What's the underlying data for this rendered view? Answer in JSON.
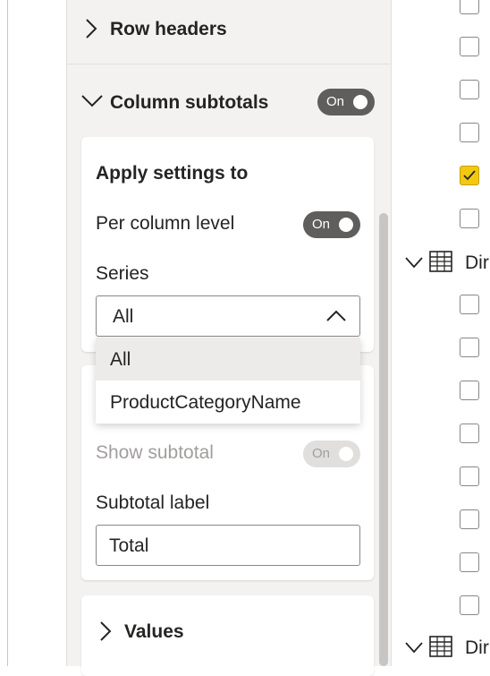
{
  "format_pane": {
    "row_headers": {
      "label": "Row headers"
    },
    "column_subtotals": {
      "label": "Column subtotals",
      "toggle_label": "On",
      "apply_settings_title": "Apply settings to",
      "per_column_level": {
        "label": "Per column level",
        "toggle_label": "On"
      },
      "series": {
        "label": "Series",
        "selected": "All",
        "options": [
          "All",
          "ProductCategoryName"
        ]
      },
      "show_subtotal": {
        "label": "Show subtotal",
        "toggle_label": "On"
      },
      "subtotal_label": {
        "label": "Subtotal label",
        "value": "Total"
      }
    },
    "values": {
      "label": "Values"
    }
  },
  "fields_pane": {
    "tables": [
      {
        "name": "Dir"
      },
      {
        "name": "Dir"
      }
    ],
    "checkboxes": [
      {
        "checked": false
      },
      {
        "checked": false
      },
      {
        "checked": false
      },
      {
        "checked": false
      },
      {
        "checked": true
      },
      {
        "checked": false
      },
      {
        "checked": false
      },
      {
        "checked": false
      },
      {
        "checked": false
      },
      {
        "checked": false
      },
      {
        "checked": false
      },
      {
        "checked": false
      },
      {
        "checked": false
      },
      {
        "checked": false
      }
    ]
  },
  "colors": {
    "toggle_on": "#605e5c",
    "checkbox_checked": "#f2c811",
    "pane_background": "#f3f2f1"
  }
}
